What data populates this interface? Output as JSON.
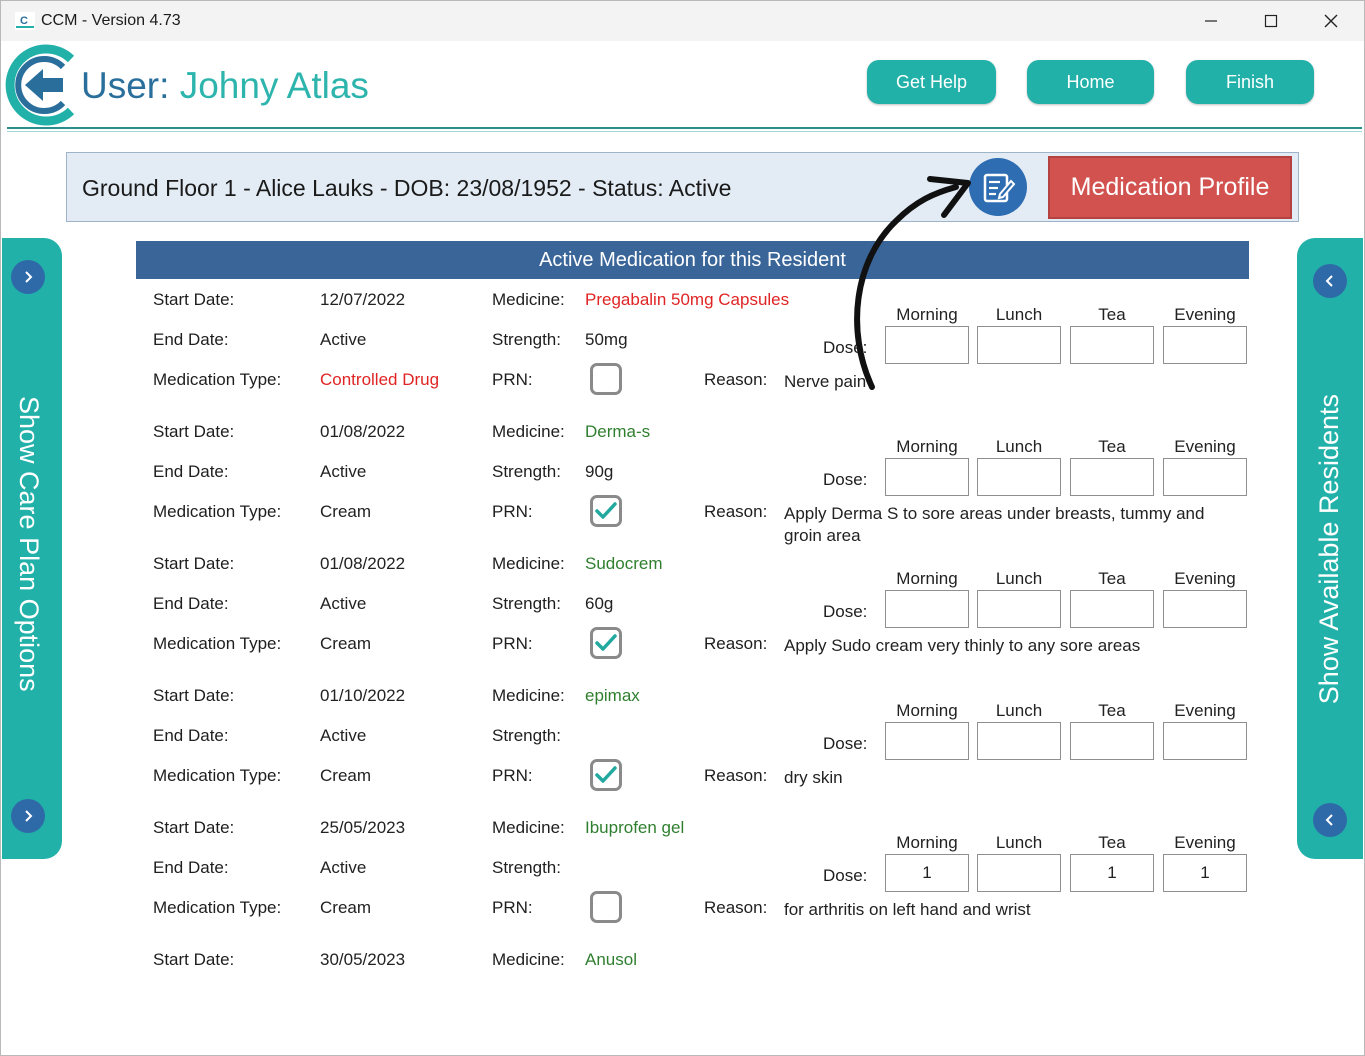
{
  "window": {
    "title": "CCM - Version 4.73"
  },
  "header": {
    "user_prefix": "User:",
    "user_name": "Johny Atlas",
    "buttons": {
      "help": "Get Help",
      "home": "Home",
      "finish": "Finish"
    }
  },
  "banner": {
    "text": "Ground Floor 1 - Alice Lauks - DOB: 23/08/1952 - Status: Active",
    "profile_button": "Medication Profile"
  },
  "side": {
    "left": "Show Care Plan Options",
    "right": "Show Available Residents"
  },
  "section": {
    "title": "Active Medication for this Resident"
  },
  "labels": {
    "start": "Start Date:",
    "end": "End Date:",
    "type": "Medication Type:",
    "medicine": "Medicine:",
    "strength": "Strength:",
    "prn": "PRN:",
    "reason": "Reason:",
    "dose": "Dose:",
    "morning": "Morning",
    "lunch": "Lunch",
    "tea": "Tea",
    "evening": "Evening"
  },
  "meds": [
    {
      "start": "12/07/2022",
      "end": "Active",
      "type": "Controlled Drug",
      "type_color": "red",
      "medicine": "Pregabalin 50mg Capsules",
      "medicine_color": "red",
      "strength": "50mg",
      "prn": false,
      "reason": "Nerve pain",
      "dose": {
        "morning": "",
        "lunch": "",
        "tea": "",
        "evening": ""
      }
    },
    {
      "start": "01/08/2022",
      "end": "Active",
      "type": "Cream",
      "type_color": "normal",
      "medicine": "Derma-s",
      "medicine_color": "green",
      "strength": "90g",
      "prn": true,
      "reason": "Apply Derma S to sore areas under breasts, tummy and groin area",
      "dose": {
        "morning": "",
        "lunch": "",
        "tea": "",
        "evening": ""
      }
    },
    {
      "start": "01/08/2022",
      "end": "Active",
      "type": "Cream",
      "type_color": "normal",
      "medicine": "Sudocrem",
      "medicine_color": "green",
      "strength": "60g",
      "prn": true,
      "reason": "Apply Sudo cream very thinly to any sore areas",
      "dose": {
        "morning": "",
        "lunch": "",
        "tea": "",
        "evening": ""
      }
    },
    {
      "start": "01/10/2022",
      "end": "Active",
      "type": "Cream",
      "type_color": "normal",
      "medicine": "epimax",
      "medicine_color": "green",
      "strength": "",
      "prn": true,
      "reason": "dry skin",
      "dose": {
        "morning": "",
        "lunch": "",
        "tea": "",
        "evening": ""
      }
    },
    {
      "start": "25/05/2023",
      "end": "Active",
      "type": "Cream",
      "type_color": "normal",
      "medicine": "Ibuprofen gel",
      "medicine_color": "green",
      "strength": "",
      "prn": false,
      "reason": "for arthritis on left hand and wrist",
      "dose": {
        "morning": "1",
        "lunch": "",
        "tea": "1",
        "evening": "1"
      }
    },
    {
      "start": "30/05/2023",
      "medicine": "Anusol",
      "medicine_color": "green"
    }
  ],
  "colors": {
    "teal": "#21b1a9",
    "navy": "#3a6598",
    "red_button": "#d25250",
    "blue_circle": "#2f6aa8"
  }
}
